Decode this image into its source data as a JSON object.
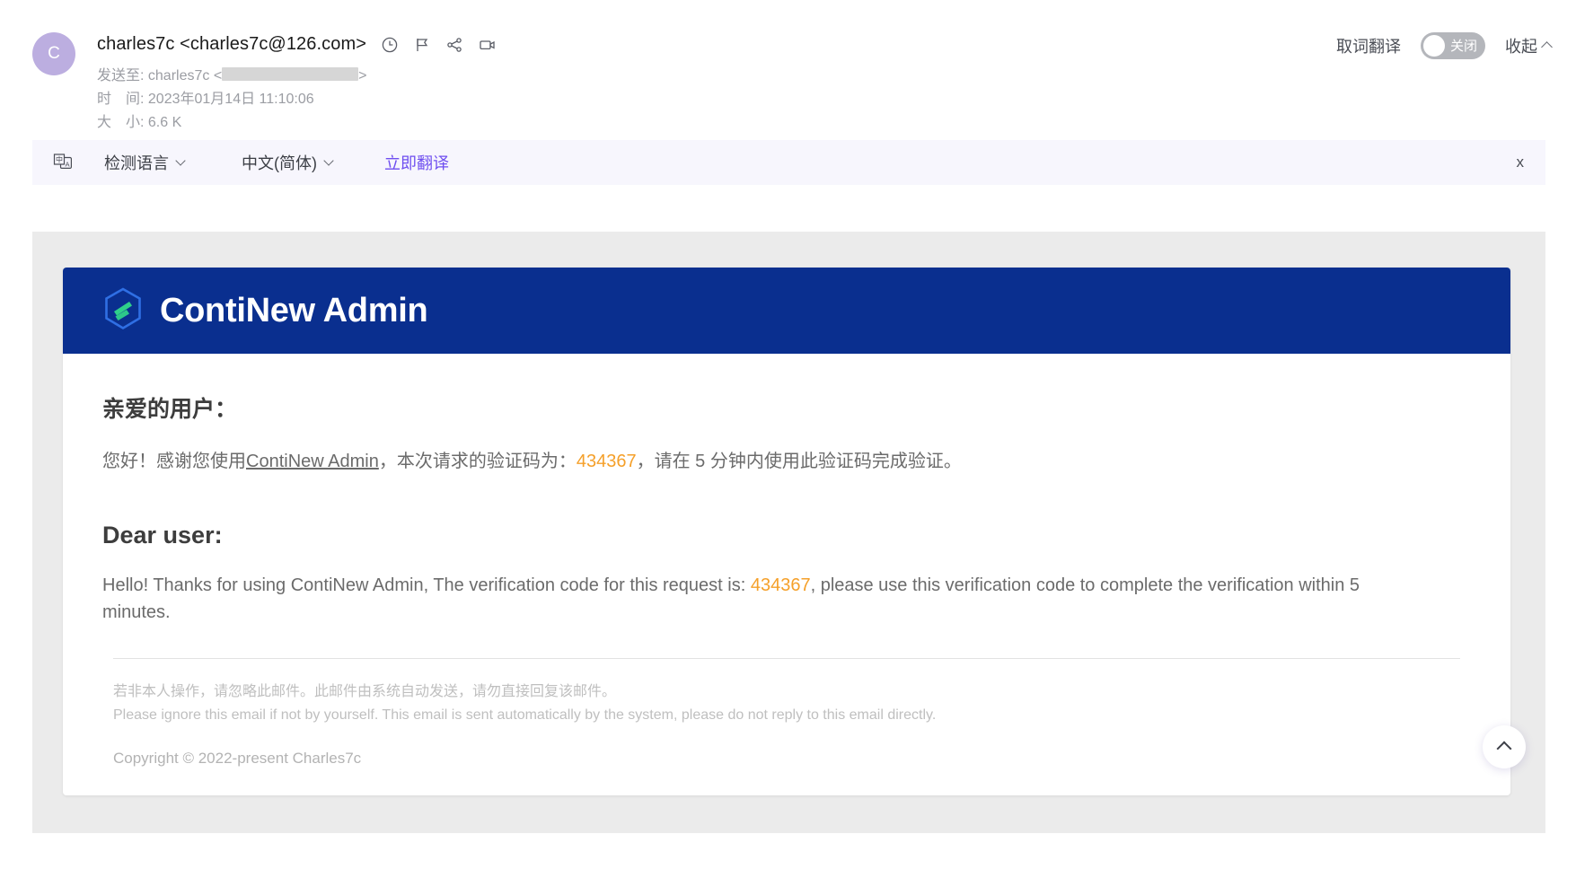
{
  "mail": {
    "avatar_initial": "C",
    "from": "charles7c <charles7c@126.com>",
    "header_icons": [
      "clock-icon",
      "flag-icon",
      "share-icon",
      "video-icon"
    ],
    "to_label": "发送至:",
    "to_value": "charles7c <",
    "to_value_end": ">",
    "time_label": "时　间:",
    "time_value": "2023年01月14日 11:10:06",
    "size_label": "大　小:",
    "size_value": "6.6 K"
  },
  "header_controls": {
    "word_translate_label": "取词翻译",
    "toggle_state_label": "关闭",
    "collapse_label": "收起"
  },
  "translate_bar": {
    "icon": "translate-icon",
    "source_language": "检测语言",
    "target_language": "中文(简体)",
    "action": "立即翻译",
    "close": "x"
  },
  "email": {
    "brand": "ContiNew Admin",
    "logo": "hexagon-logo-icon",
    "greeting_cn": "亲爱的用户：",
    "body_cn_pre": "您好！感谢您使用",
    "body_cn_brand": "ContiNew Admin",
    "body_cn_mid": "，本次请求的验证码为：",
    "verification_code": "434367",
    "body_cn_post": "，请在 5 分钟内使用此验证码完成验证。",
    "greeting_en": "Dear user:",
    "body_en_pre": "Hello! Thanks for using ContiNew Admin, The verification code for this request is: ",
    "body_en_post": ", please use this verification code to complete the verification within 5 minutes.",
    "fine_print_cn": "若非本人操作，请忽略此邮件。此邮件由系统自动发送，请勿直接回复该邮件。",
    "fine_print_en": "Please ignore this email if not by yourself. This email is sent automatically by the system, please do not reply to this email directly.",
    "copyright": "Copyright © 2022-present Charles7c"
  },
  "colors": {
    "banner_blue": "#0a2f8f",
    "code_orange": "#f5a02a",
    "translate_purple": "#6f4ff0",
    "avatar_purple": "#bcaee0"
  }
}
